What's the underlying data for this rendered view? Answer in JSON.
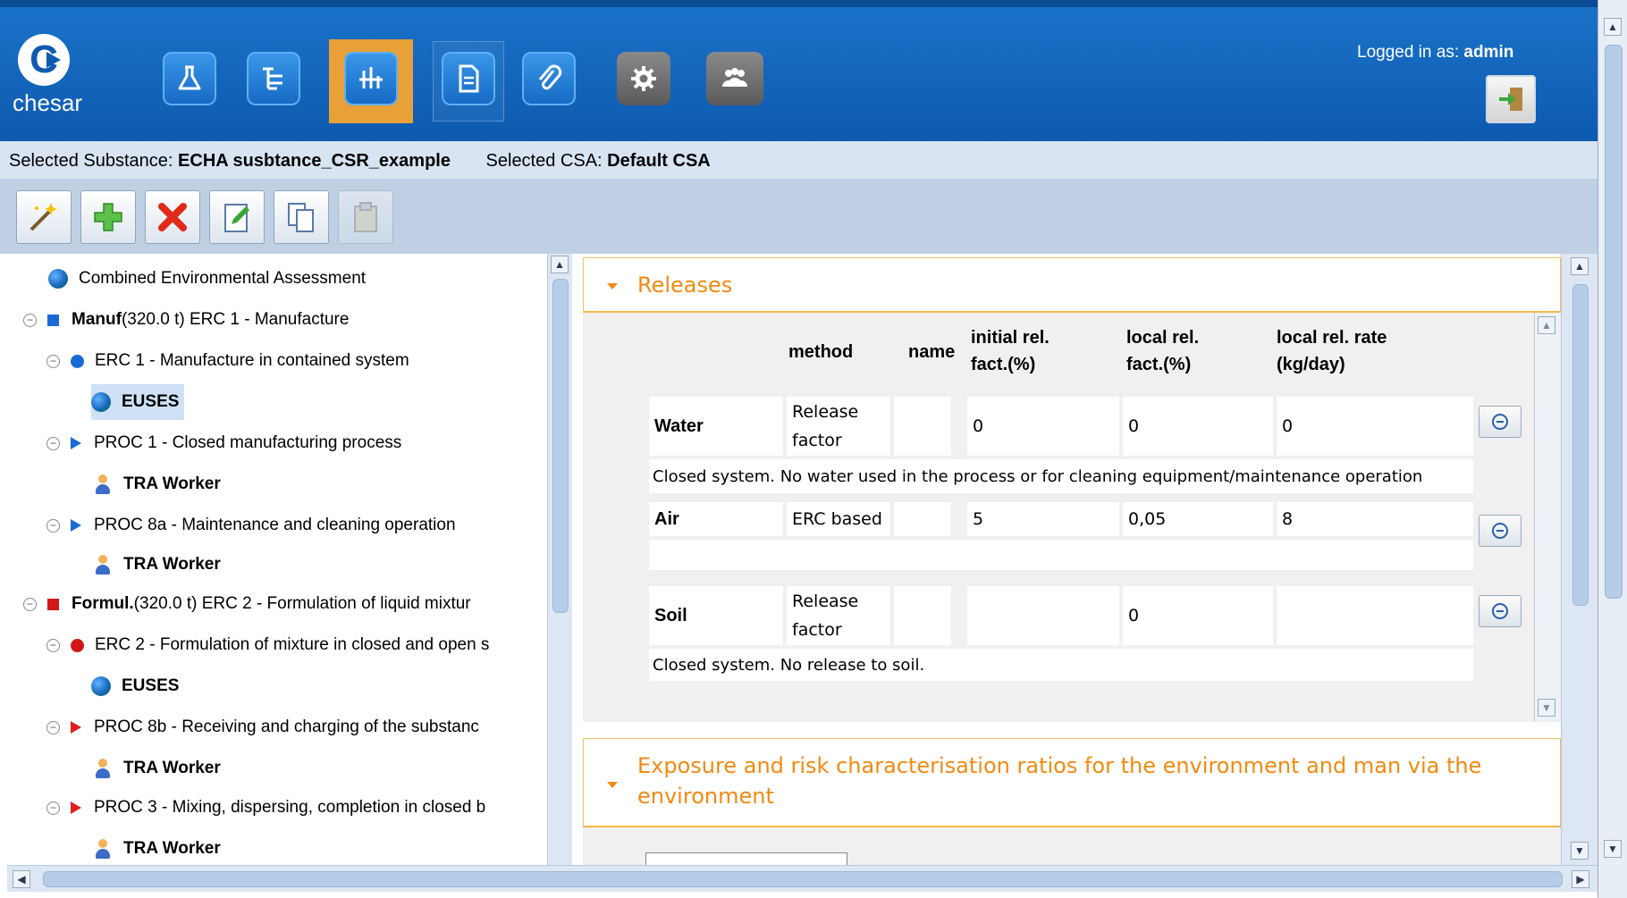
{
  "app": {
    "name": "chesar"
  },
  "header": {
    "logged_in_label": "Logged in as:",
    "user": "admin"
  },
  "nav_icons": [
    "flask-icon",
    "tree-icon",
    "chart-icon",
    "document-icon",
    "paperclip-icon",
    "gear-icon",
    "users-icon"
  ],
  "selection": {
    "substance_label": "Selected Substance:",
    "substance": "ECHA susbtance_CSR_example",
    "csa_label": "Selected CSA:",
    "csa": "Default CSA"
  },
  "toolbar": [
    "wizard-icon",
    "add-icon",
    "delete-icon",
    "edit-icon",
    "copy-icon",
    "paste-icon"
  ],
  "tree": {
    "items": [
      {
        "label": "Combined Environmental Assessment"
      },
      {
        "label_bold": "Manuf",
        "label": " (320.0 t) ERC 1 - Manufacture"
      },
      {
        "label": "ERC 1 - Manufacture in contained system"
      },
      {
        "label": "EUSES"
      },
      {
        "label": "PROC 1 - Closed manufacturing process"
      },
      {
        "label": "TRA Worker"
      },
      {
        "label": "PROC 8a - Maintenance and cleaning operation"
      },
      {
        "label": "TRA Worker"
      },
      {
        "label_bold": "Formul.",
        "label": " (320.0 t) ERC 2 - Formulation of liquid mixtur"
      },
      {
        "label": "ERC 2 - Formulation of mixture in closed and open s"
      },
      {
        "label": "EUSES"
      },
      {
        "label": "PROC 8b - Receiving and charging of the substanc"
      },
      {
        "label": "TRA Worker"
      },
      {
        "label": "PROC 3 - Mixing, dispersing, completion in closed b"
      },
      {
        "label": "TRA Worker"
      }
    ]
  },
  "releases": {
    "title": "Releases",
    "headers": {
      "method": "method",
      "name": "name",
      "initial": [
        "initial rel.",
        "fact.(%)"
      ],
      "local": [
        "local rel.",
        "fact.(%)"
      ],
      "rate": [
        "local rel. rate",
        "(kg/day)"
      ]
    },
    "rows": [
      {
        "compartment": "Water",
        "method": [
          "Release",
          "factor"
        ],
        "name": "",
        "initial": "0",
        "local": "0",
        "rate": "0",
        "note": "Closed system. No water used in the process or for cleaning equipment/maintenance operation"
      },
      {
        "compartment": "Air",
        "method": [
          "ERC based",
          ""
        ],
        "name": "",
        "initial": "5",
        "local": "0,05",
        "rate": "8",
        "note": ""
      },
      {
        "compartment": "Soil",
        "method": [
          "Release",
          "factor"
        ],
        "name": "",
        "initial": "",
        "local": "0",
        "rate": "",
        "note": "Closed system. No release to soil."
      }
    ]
  },
  "exposure": {
    "title_line1": "Exposure and risk characterisation ratios for the environment and man via the",
    "title_line2": "environment"
  },
  "colors": {
    "accent": "#f28a12",
    "header_blue": "#0d5ab0",
    "selected_nav": "#e8a038"
  }
}
